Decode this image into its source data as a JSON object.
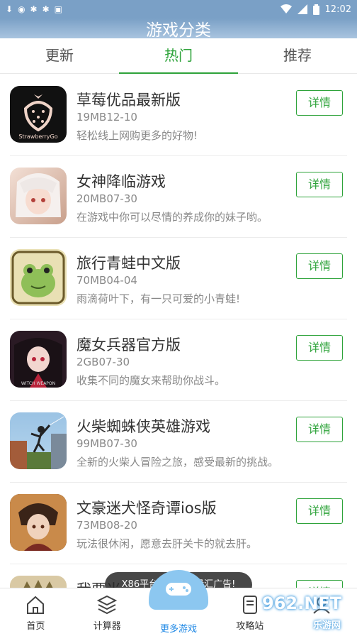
{
  "status_bar": {
    "left_icons": [
      "download-icon",
      "notification-icon",
      "bug-icon",
      "bug-icon",
      "app-icon"
    ],
    "time": "12:02"
  },
  "header": {
    "title": "游戏分类"
  },
  "tabs": [
    {
      "label": "更新",
      "active": false
    },
    {
      "label": "热门",
      "active": true
    },
    {
      "label": "推荐",
      "active": false
    }
  ],
  "items": [
    {
      "title": "草莓优品最新版",
      "meta": "19MB12-10",
      "desc": "轻松线上网购更多的好物!",
      "button": "详情",
      "icon_text": "StrawberryGo",
      "icon_colors": [
        "#111111",
        "#f0d4c8"
      ]
    },
    {
      "title": "女神降临游戏",
      "meta": "20MB07-30",
      "desc": "在游戏中你可以尽情的养成你的妹子哟。",
      "button": "详情",
      "icon_colors": [
        "#f3e0d6",
        "#c9a08c"
      ]
    },
    {
      "title": "旅行青蛙中文版",
      "meta": "70MB04-04",
      "desc": "雨滴荷叶下，有一只可爱的小青蛙!",
      "button": "详情",
      "icon_colors": [
        "#e9e0b4",
        "#8fbf58"
      ]
    },
    {
      "title": "魔女兵器官方版",
      "meta": "2GB07-30",
      "desc": "收集不同的魔女来帮助你战斗。",
      "button": "详情",
      "icon_text": "WITCH WEAPON",
      "icon_colors": [
        "#2a1a24",
        "#b8233a"
      ]
    },
    {
      "title": "火柴蜘蛛侠英雄游戏",
      "meta": "99MB07-30",
      "desc": "全新的火柴人冒险之旅，感受最新的挑战。",
      "button": "详情",
      "icon_colors": [
        "#9bc3e4",
        "#a35c3a"
      ]
    },
    {
      "title": "文豪迷犬怪奇谭ios版",
      "meta": "73MB08-20",
      "desc": "玩法很休闲，愿意去肝关卡的就去肝。",
      "button": "详情",
      "icon_colors": [
        "#3a2418",
        "#c98a4a"
      ]
    },
    {
      "title": "我要当",
      "meta": "",
      "desc": "",
      "button": "详情",
      "icon_colors": [
        "#d9c9a4",
        "#7a6a3a"
      ]
    }
  ],
  "toast": "X86平台不支持优量汇广告!",
  "bottom_nav": [
    {
      "label": "首页",
      "icon": "home-icon"
    },
    {
      "label": "计算器",
      "icon": "layers-icon"
    },
    {
      "label": "更多游戏",
      "icon": "gamepad-icon"
    },
    {
      "label": "攻略站",
      "icon": "book-icon"
    },
    {
      "label": "",
      "icon": "user-icon"
    }
  ],
  "watermark": {
    "main": "962.NET",
    "sub": "乐游网"
  },
  "colors": {
    "accent": "#2ea33a",
    "header_bg": "#7aa0c6",
    "nav_bubble": "#8cc7f0"
  }
}
